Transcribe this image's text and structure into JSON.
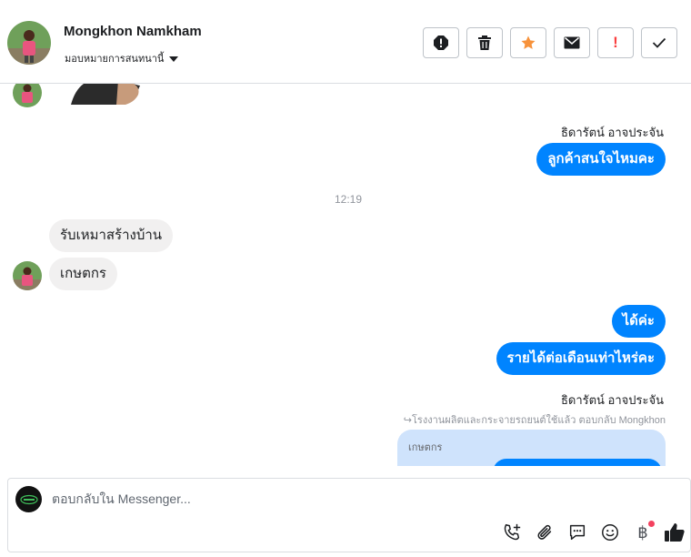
{
  "header": {
    "contact_name": "Mongkhon Namkham",
    "assign_label": "มอบหมายการสนทนานี้",
    "toolbar": [
      {
        "icon": "alert-circle-icon"
      },
      {
        "icon": "trash-icon"
      },
      {
        "icon": "star-icon"
      },
      {
        "icon": "envelope-icon"
      },
      {
        "icon": "exclamation-icon",
        "label": "!"
      },
      {
        "icon": "check-icon"
      }
    ]
  },
  "thread": {
    "sender_1": "ธิดารัตน์ อาจประจัน",
    "out_1": "ลูกค้าสนใจไหมคะ",
    "time_1": "12:19",
    "in_1": "รับเหมาสร้างบ้าน",
    "in_2": "เกษตกร",
    "out_2": "ได้ค่ะ",
    "out_3": "รายได้ต่อเดือนเท่าไหร่คะ",
    "sender_2": "ธิดารัตน์ อาจประจัน",
    "reply_meta": "↪โรงงานผลิตและกระจายรถยนต์ใช้แล้ว ตอบกลับ Mongkhon",
    "quoted_text": "เกษตกร"
  },
  "composer": {
    "placeholder": "ตอบกลับใน Messenger...",
    "icons": [
      "phone-add-icon",
      "paperclip-icon",
      "saved-reply-icon",
      "emoji-icon",
      "baht-icon",
      "thumbs-up-icon"
    ],
    "baht_symbol": "฿"
  },
  "colors": {
    "accent": "#0084ff",
    "star": "#f7923b",
    "alert": "#fa3e3e",
    "incoming_bubble": "#f1f0f0",
    "quoted_bg": "#cfe3fc"
  }
}
